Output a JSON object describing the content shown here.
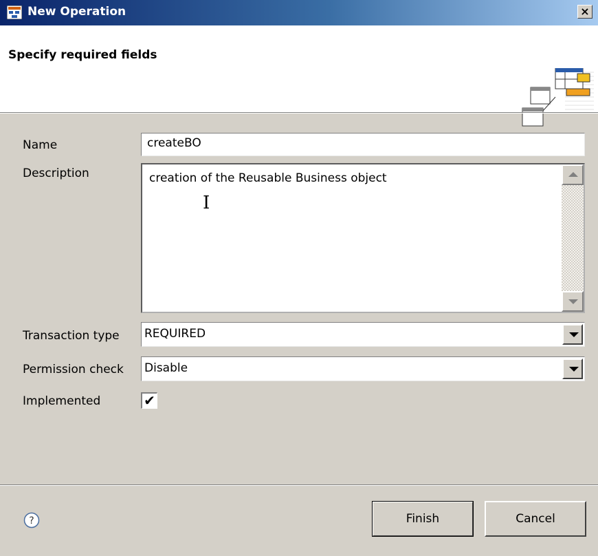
{
  "window": {
    "title": "New Operation",
    "close_label": "×"
  },
  "banner": {
    "title": "Specify required fields"
  },
  "form": {
    "name_label": "Name",
    "name_value": "createBO",
    "description_label": "Description",
    "description_value": "creation of the Reusable Business object",
    "transaction_label": "Transaction type",
    "transaction_value": "REQUIRED",
    "permission_label": "Permission check",
    "permission_value": "Disable",
    "implemented_label": "Implemented",
    "implemented_checked": true,
    "implemented_mark": "✔"
  },
  "footer": {
    "finish_label": "Finish",
    "cancel_label": "Cancel"
  },
  "icons": {
    "app": "app-icon",
    "help": "help-icon",
    "banner": "wizard-graphic-icon"
  },
  "colors": {
    "title_start": "#0a246a",
    "title_end": "#a6caf0",
    "dialog_bg": "#d4d0c8"
  }
}
